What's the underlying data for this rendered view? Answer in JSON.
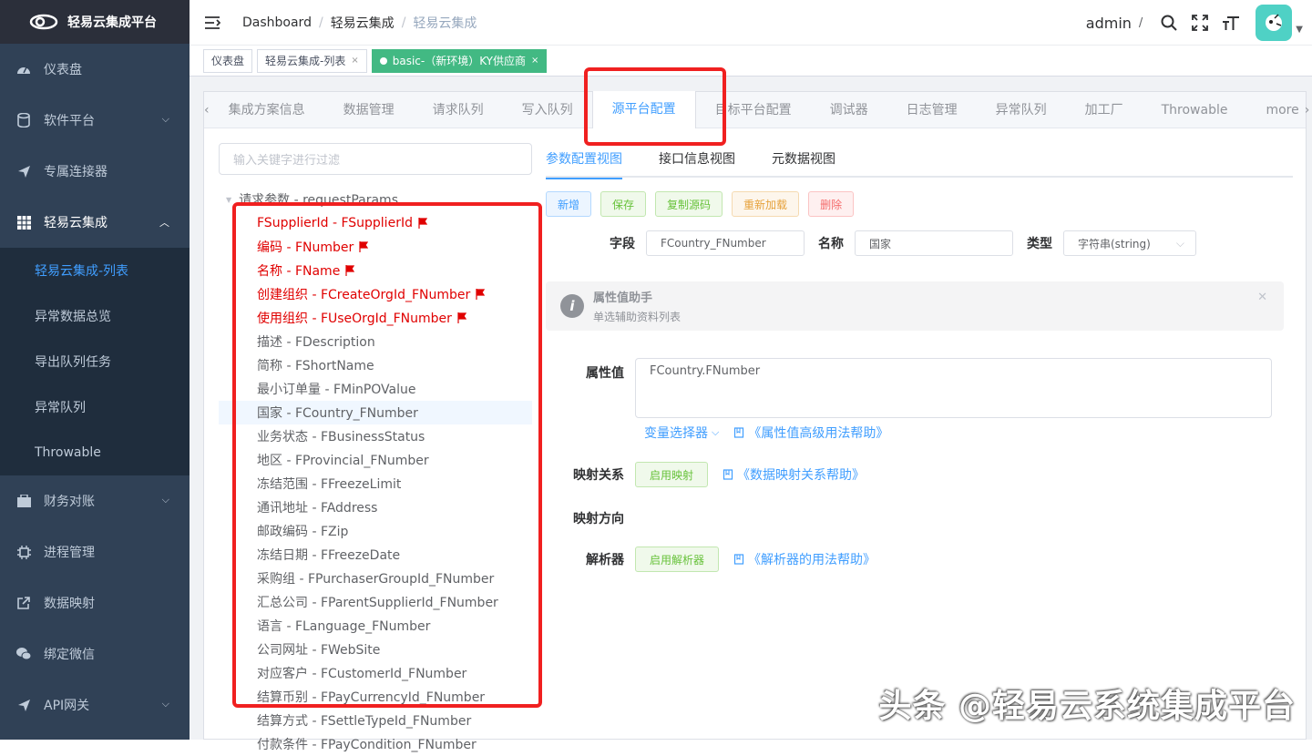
{
  "sidebar": {
    "logo": "轻易云集成平台",
    "items": [
      {
        "label": "仪表盘",
        "icon": "dashboard-icon"
      },
      {
        "label": "软件平台",
        "icon": "software-icon"
      },
      {
        "label": "专属连接器",
        "icon": "send-icon"
      },
      {
        "label": "轻易云集成",
        "icon": "table-icon"
      },
      {
        "label": "财务对账",
        "icon": "finance-icon"
      },
      {
        "label": "进程管理",
        "icon": "cpu-icon"
      },
      {
        "label": "数据映射",
        "icon": "external-link-icon"
      },
      {
        "label": "绑定微信",
        "icon": "wechat-icon"
      },
      {
        "label": "API网关",
        "icon": "api-icon"
      }
    ],
    "sub_items": [
      "轻易云集成-列表",
      "异常数据总览",
      "导出队列任务",
      "异常队列",
      "Throwable"
    ]
  },
  "navbar": {
    "crumbs": [
      "Dashboard",
      "轻易云集成",
      "轻易云集成"
    ],
    "user": "admin",
    "sep": "/"
  },
  "tags": [
    "仪表盘",
    "轻易云集成-列表",
    "basic-（新环境）KY供应商"
  ],
  "tabs": [
    "集成方案信息",
    "数据管理",
    "请求队列",
    "写入队列",
    "源平台配置",
    "目标平台配置",
    "调试器",
    "日志管理",
    "异常队列",
    "加工厂",
    "Throwable",
    "more"
  ],
  "filter_placeholder": "输入关键字进行过滤",
  "tree": {
    "root": "请求参数 - requestParams",
    "nodes": [
      "FSupplierId - FSupplierId",
      "编码 - FNumber",
      "名称 - FName",
      "创建组织 - FCreateOrgId_FNumber",
      "使用组织 - FUseOrgId_FNumber",
      "描述 - FDescription",
      "简称 - FShortName",
      "最小订单量 - FMinPOValue",
      "国家 - FCountry_FNumber",
      "业务状态 - FBusinessStatus",
      "地区 - FProvincial_FNumber",
      "冻结范围 - FFreezeLimit",
      "通讯地址 - FAddress",
      "邮政编码 - FZip",
      "冻结日期 - FFreezeDate",
      "采购组 - FPurchaserGroupId_FNumber",
      "汇总公司 - FParentSupplierId_FNumber",
      "语言 - FLanguage_FNumber",
      "公司网址 - FWebSite",
      "对应客户 - FCustomerId_FNumber",
      "结算币别 - FPayCurrencyId_FNumber",
      "结算方式 - FSettleTypeId_FNumber",
      "付款条件 - FPayCondition_FNumber"
    ]
  },
  "subtabs": [
    "参数配置视图",
    "接口信息视图",
    "元数据视图"
  ],
  "buttons": [
    "新增",
    "保存",
    "复制源码",
    "重新加载",
    "删除"
  ],
  "field": {
    "label": "字段",
    "value": "FCountry_FNumber",
    "name_label": "名称",
    "name_value": "国家",
    "type_label": "类型",
    "type_value": "字符串(string)"
  },
  "alert": {
    "title": "属性值助手",
    "desc": "单选辅助资料列表"
  },
  "prop": {
    "value_label": "属性值",
    "value": "FCountry.FNumber",
    "var_selector": "变量选择器",
    "value_help": "《属性值高级用法帮助》",
    "map_label": "映射关系",
    "map_btn": "启用映射",
    "map_help": "《数据映射关系帮助》",
    "dir_label": "映射方向",
    "parser_label": "解析器",
    "parser_btn": "启用解析器",
    "parser_help": "《解析器的用法帮助》"
  },
  "watermark": "头条 @轻易云系统集成平台",
  "colors": {
    "sidebar": "#304156",
    "accent": "#409eff",
    "required": "#e00000",
    "highlight": "#f02020"
  }
}
